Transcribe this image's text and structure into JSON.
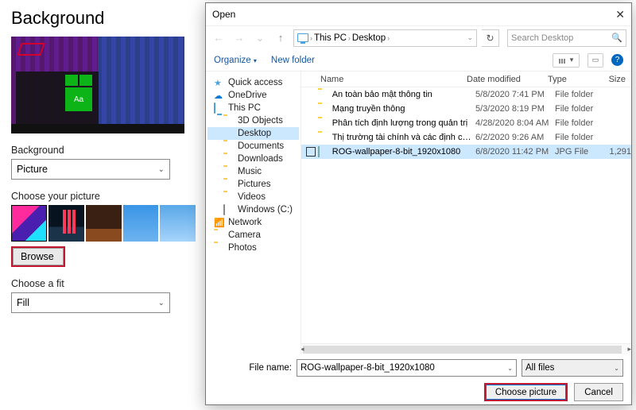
{
  "settings": {
    "title": "Background",
    "preview_tile_text": "Aa",
    "bg_label": "Background",
    "bg_value": "Picture",
    "choose_label": "Choose your picture",
    "browse_label": "Browse",
    "fit_label": "Choose a fit",
    "fit_value": "Fill"
  },
  "dialog": {
    "title": "Open",
    "breadcrumb": {
      "root": "This PC",
      "current": "Desktop"
    },
    "search_placeholder": "Search Desktop",
    "organize": "Organize",
    "new_folder": "New folder",
    "tree": [
      {
        "label": "Quick access",
        "icon": "star",
        "level": 1
      },
      {
        "label": "OneDrive",
        "icon": "cloud",
        "level": 1
      },
      {
        "label": "This PC",
        "icon": "pc",
        "level": 1
      },
      {
        "label": "3D Objects",
        "icon": "folder",
        "level": 2
      },
      {
        "label": "Desktop",
        "icon": "desktop",
        "level": 2,
        "selected": true
      },
      {
        "label": "Documents",
        "icon": "folder",
        "level": 2
      },
      {
        "label": "Downloads",
        "icon": "folder",
        "level": 2
      },
      {
        "label": "Music",
        "icon": "folder",
        "level": 2
      },
      {
        "label": "Pictures",
        "icon": "folder",
        "level": 2
      },
      {
        "label": "Videos",
        "icon": "folder",
        "level": 2
      },
      {
        "label": "Windows (C:)",
        "icon": "drive",
        "level": 2
      },
      {
        "label": "Network",
        "icon": "net",
        "level": 1
      },
      {
        "label": "Camera",
        "icon": "folder",
        "level": 1
      },
      {
        "label": "Photos",
        "icon": "folder",
        "level": 1
      }
    ],
    "columns": {
      "name": "Name",
      "date": "Date modified",
      "type": "Type",
      "size": "Size"
    },
    "rows": [
      {
        "name": "An toàn bảo mật thông tin",
        "date": "5/8/2020 7:41 PM",
        "type": "File folder",
        "size": "",
        "icon": "folder"
      },
      {
        "name": "Mạng truyền thông",
        "date": "5/3/2020 8:19 PM",
        "type": "File folder",
        "size": "",
        "icon": "folder"
      },
      {
        "name": "Phân tích định lượng trong quản trị",
        "date": "4/28/2020 8:04 AM",
        "type": "File folder",
        "size": "",
        "icon": "folder"
      },
      {
        "name": "Thị trường tài chính và các định chế tài c...",
        "date": "6/2/2020 9:26 AM",
        "type": "File folder",
        "size": "",
        "icon": "folder"
      },
      {
        "name": "ROG-wallpaper-8-bit_1920x1080",
        "date": "6/8/2020 11:42 PM",
        "type": "JPG File",
        "size": "1,291",
        "icon": "jpg",
        "selected": true
      }
    ],
    "filename_label": "File name:",
    "filename_value": "ROG-wallpaper-8-bit_1920x1080",
    "filter_value": "All files",
    "choose_btn": "Choose picture",
    "cancel_btn": "Cancel"
  }
}
